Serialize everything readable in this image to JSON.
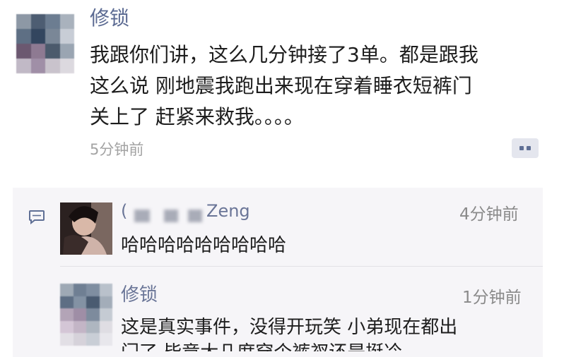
{
  "post": {
    "author": "修锁",
    "text_lines": [
      "我跟你们讲，这么几分钟接了3单。都是跟我",
      "这么说 刚地震我跑出来现在穿着睡衣短裤门",
      "关上了 赶紧来救我。。。。"
    ],
    "time": "5分钟前",
    "more_icon": "more-dots-icon"
  },
  "comments": {
    "icon": "comment-bubble-icon",
    "items": [
      {
        "author_prefix": "(",
        "author_suffix": "Zeng",
        "time": "4分钟前",
        "text": "哈哈哈哈哈哈哈哈哈"
      },
      {
        "author": "修锁",
        "time": "1分钟前",
        "text_lines": [
          "这是真实事件，没得开玩笑 小弟现在都出",
          "门了 毕竟大几度穿个裤衩还是挺冷"
        ]
      }
    ]
  },
  "colors": {
    "name_link": "#5b6a92",
    "time_gray": "#a3a3a3",
    "comment_bg": "#f6f5f8"
  }
}
